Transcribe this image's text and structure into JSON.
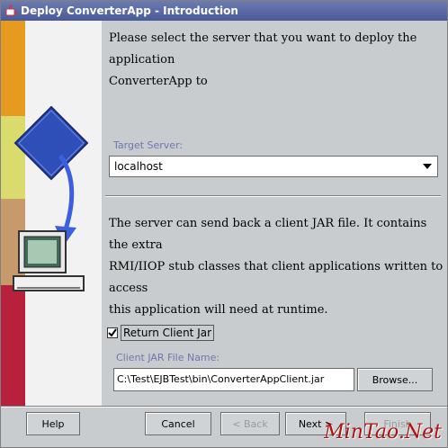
{
  "window": {
    "title": "Deploy ConverterApp - Introduction"
  },
  "intro": {
    "line1": "Please select the server that you want to deploy the application",
    "line2": "ConverterApp to"
  },
  "target_server": {
    "label": "Target Server:",
    "selected": "localhost"
  },
  "description": {
    "line1": "The server can send back a client JAR file. It contains the extra",
    "line2": "RMI/IIOP stub classes that client applications written to access",
    "line3": "this application will need at runtime."
  },
  "return_client_jar": {
    "label": "Return Client Jar",
    "checked": true
  },
  "client_jar": {
    "label": "Client JAR File Name:",
    "value": "C:\\Test\\EJBTest\\bin\\ConverterAppClient.jar",
    "browse_label": "Browse..."
  },
  "footer": {
    "help_label": "Help",
    "cancel_label": "Cancel",
    "back_label": "< Back",
    "next_label": "Next >",
    "finish_label": "Finish"
  },
  "watermark": "MinTao.Net",
  "colors": {
    "stripe_orange": "#e69a1e",
    "stripe_yellow": "#d9dc6c",
    "stripe_tan": "#c69a6a",
    "stripe_red": "#b8213c",
    "diamond_blue": "#2f4fb8",
    "arrow_blue": "#3a5fe0"
  },
  "icons": {
    "window": "java-cup-icon",
    "dropdown": "chevron-down-icon",
    "checkbox": "checkmark-icon",
    "diamond": "server-diamond-icon",
    "arrow": "deploy-arrow-icon",
    "computer": "computer-icon"
  }
}
